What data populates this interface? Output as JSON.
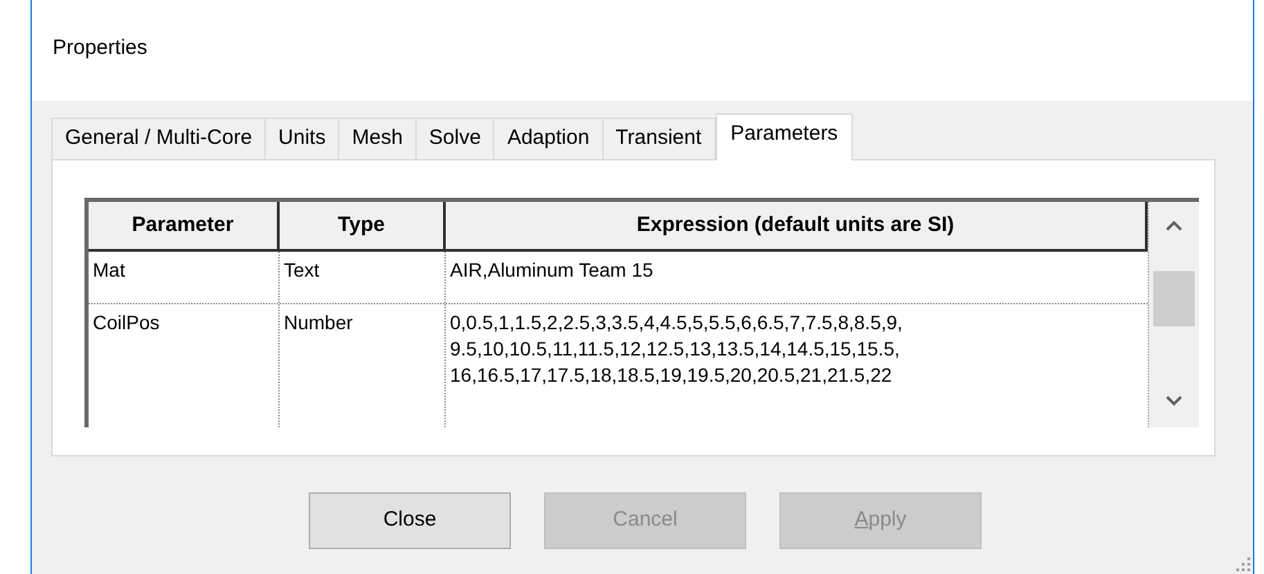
{
  "window": {
    "title": "Properties"
  },
  "tabs": [
    {
      "label": "General / Multi-Core",
      "selected": false
    },
    {
      "label": "Units",
      "selected": false
    },
    {
      "label": "Mesh",
      "selected": false
    },
    {
      "label": "Solve",
      "selected": false
    },
    {
      "label": "Adaption",
      "selected": false
    },
    {
      "label": "Transient",
      "selected": false
    },
    {
      "label": "Parameters",
      "selected": true
    }
  ],
  "table": {
    "columns": [
      "Parameter",
      "Type",
      "Expression (default units are SI)"
    ],
    "rows": [
      {
        "cells": [
          "Mat",
          "Text",
          "AIR,Aluminum Team 15"
        ]
      },
      {
        "cells": [
          "CoilPos",
          "Number",
          "0,0.5,1,1.5,2,2.5,3,3.5,4,4.5,5,5.5,6,6.5,7,7.5,8,8.5,9, 9.5,10,10.5,11,11.5,12,12.5,13,13.5,14,14.5,15,15.5, 16,16.5,17,17.5,18,18.5,19,19.5,20,20.5,21,21.5,22"
        ]
      }
    ]
  },
  "buttons": [
    {
      "label": "Close",
      "disabled": false,
      "mnemonic": false
    },
    {
      "label": "Cancel",
      "disabled": true,
      "mnemonic": false
    },
    {
      "label": "Apply",
      "disabled": true,
      "mnemonic": true
    }
  ]
}
